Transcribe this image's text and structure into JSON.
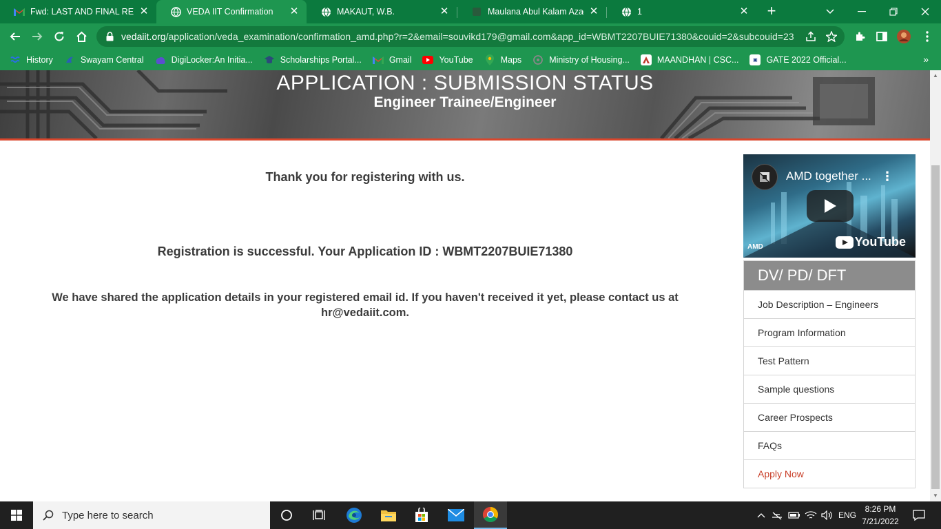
{
  "browser": {
    "tabs": [
      {
        "title": "Fwd: LAST AND FINAL REMIN",
        "icon": "gmail-icon",
        "active": false
      },
      {
        "title": "VEDA IIT Confirmation",
        "icon": "globe-icon",
        "active": true
      },
      {
        "title": "MAKAUT, W.B.",
        "icon": "globe-icon",
        "active": false
      },
      {
        "title": "Maulana Abul Kalam Azad Ur",
        "icon": "site-icon",
        "active": false
      },
      {
        "title": "1",
        "icon": "globe-icon",
        "active": false
      }
    ],
    "url_domain": "vedaiit.org",
    "url_path": "/application/veda_examination/confirmation_amd.php?r=2&email=souvikd179@gmail.com&app_id=WBMT2207BUIE71380&couid=2&subcouid=23",
    "bookmarks": [
      {
        "label": "History",
        "icon": "history-icon",
        "color": "#2b6ee6"
      },
      {
        "label": "Swayam Central",
        "icon": "swayam-icon",
        "color": "#2a5fb5"
      },
      {
        "label": "DigiLocker:An Initia...",
        "icon": "digilocker-icon",
        "color": "#5a4fcf"
      },
      {
        "label": "Scholarships Portal...",
        "icon": "scholarship-icon",
        "color": "#2b4a7a"
      },
      {
        "label": "Gmail",
        "icon": "gmail-icon",
        "color": "#ea4335"
      },
      {
        "label": "YouTube",
        "icon": "youtube-icon",
        "color": "#ff0000"
      },
      {
        "label": "Maps",
        "icon": "maps-icon",
        "color": "#34a853"
      },
      {
        "label": "Ministry of Housing...",
        "icon": "ministry-icon",
        "color": "#777777"
      },
      {
        "label": "MAANDHAN | CSC...",
        "icon": "maandhan-icon",
        "color": "#c0392b"
      },
      {
        "label": "GATE 2022 Official...",
        "icon": "gate-icon",
        "color": "#1f3f8a"
      }
    ]
  },
  "page": {
    "hero_title": "APPLICATION : SUBMISSION STATUS",
    "hero_subtitle": "Engineer Trainee/Engineer",
    "thank_you": "Thank you for registering with us.",
    "registration": "Registration is successful. Your Application ID : WBMT2207BUIE71380",
    "shared_line1": "We have shared the application details in your registered email id. If you haven't received it yet, please contact us at",
    "shared_line2": "hr@vedaiit.com."
  },
  "sidebar": {
    "video_title": "AMD together ...",
    "video_brand": "YouTube",
    "video_corner": "AMD",
    "menu_title": "DV/ PD/ DFT",
    "items": [
      {
        "label": "Job Description – Engineers"
      },
      {
        "label": "Program Information"
      },
      {
        "label": "Test Pattern"
      },
      {
        "label": "Sample questions"
      },
      {
        "label": "Career Prospects"
      },
      {
        "label": "FAQs"
      },
      {
        "label": "Apply Now"
      }
    ]
  },
  "taskbar": {
    "search_placeholder": "Type here to search",
    "language": "ENG",
    "time": "8:26 PM",
    "date": "7/21/2022"
  }
}
